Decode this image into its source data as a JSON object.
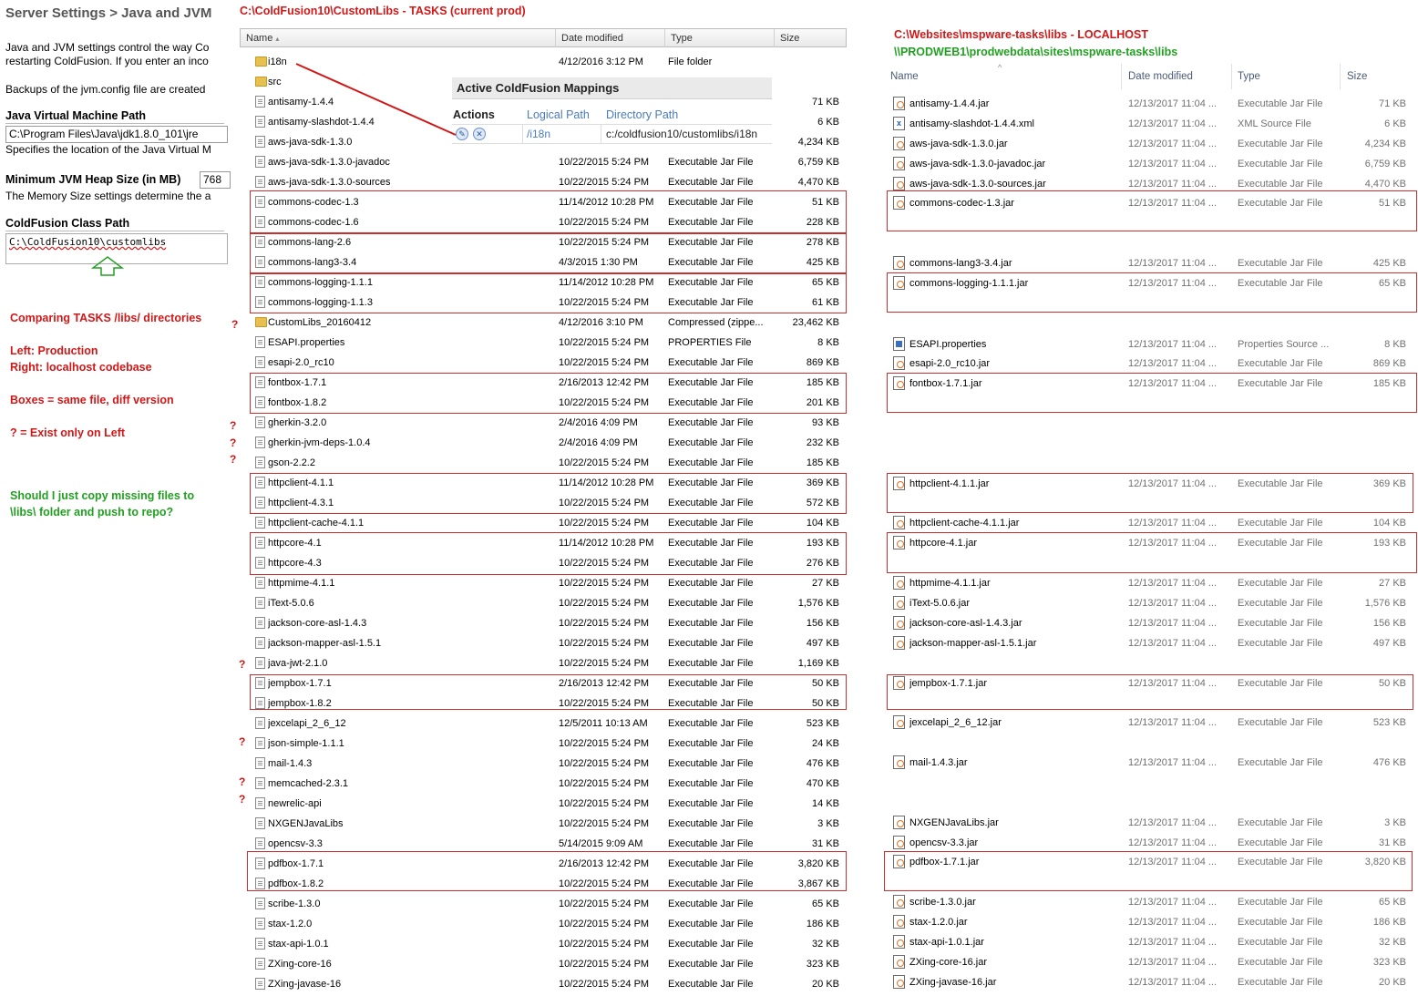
{
  "left_panel": {
    "title": "Server Settings > Java and JVM",
    "desc_line1": "Java and JVM settings control the way Co",
    "desc_line2": "restarting ColdFusion. If you enter an inco",
    "backups_text": "Backups of the jvm.config file are created",
    "jvm_path_label": "Java Virtual Machine Path",
    "jvm_path_value": "C:\\Program Files\\Java\\jdk1.8.0_101\\jre",
    "jvm_path_desc": "Specifies the location of the Java Virtual M",
    "heap_label": "Minimum JVM Heap Size (in MB)",
    "heap_value": "768",
    "heap_desc": "The Memory Size settings determine the a",
    "classpath_label": "ColdFusion Class Path",
    "classpath_value": "C:\\ColdFusion10\\customlibs"
  },
  "annotations": {
    "left_header": "C:\\ColdFusion10\\CustomLibs  - TASKS (current prod)",
    "right_header1": "C:\\Websites\\mspware-tasks\\libs  - LOCALHOST",
    "right_header2": "\\\\PRODWEB1\\prodwebdata\\sites\\mspware-tasks\\libs",
    "comparing": "Comparing TASKS /libs/ directories",
    "left_desc": "Left: Production",
    "right_desc": "Right: localhost codebase",
    "boxes_desc": "Boxes = same file, diff version",
    "q_desc": "? = Exist only on Left",
    "question1": "Should I just copy missing files to",
    "question2": "\\libs\\ folder and push to repo?",
    "qmark": "?",
    "colors": {
      "red": "#d01818",
      "green": "#22a022",
      "box": "#c83030"
    }
  },
  "cf_mappings": {
    "title": "Active ColdFusion Mappings",
    "col_actions": "Actions",
    "col_logical": "Logical Path",
    "col_directory": "Directory Path",
    "row_logical": "/i18n",
    "row_directory": "c:/coldfusion10/customlibs/i18n",
    "edit_icon": "pencil-icon",
    "delete_icon": "x-icon"
  },
  "left_explorer": {
    "columns": {
      "name": "Name",
      "date": "Date modified",
      "type": "Type",
      "size": "Size"
    },
    "rows": [
      {
        "name": "i18n",
        "date": "4/12/2016 3:12 PM",
        "type": "File folder",
        "size": "",
        "icon": "folder-icon"
      },
      {
        "name": "src",
        "date": "",
        "type": "",
        "size": "",
        "icon": "folder-icon"
      },
      {
        "name": "antisamy-1.4.4",
        "date": "",
        "type": "",
        "size": "71 KB",
        "icon": "file-icon"
      },
      {
        "name": "antisamy-slashdot-1.4.4",
        "date": "",
        "type": "",
        "size": "6 KB",
        "icon": "file-icon"
      },
      {
        "name": "aws-java-sdk-1.3.0",
        "date": "",
        "type": "",
        "size": "4,234 KB",
        "icon": "file-icon"
      },
      {
        "name": "aws-java-sdk-1.3.0-javadoc",
        "date": "10/22/2015 5:24 PM",
        "type": "Executable Jar File",
        "size": "6,759 KB",
        "icon": "file-icon"
      },
      {
        "name": "aws-java-sdk-1.3.0-sources",
        "date": "10/22/2015 5:24 PM",
        "type": "Executable Jar File",
        "size": "4,470 KB",
        "icon": "file-icon"
      },
      {
        "name": "commons-codec-1.3",
        "date": "11/14/2012 10:28 PM",
        "type": "Executable Jar File",
        "size": "51 KB",
        "icon": "file-icon"
      },
      {
        "name": "commons-codec-1.6",
        "date": "10/22/2015 5:24 PM",
        "type": "Executable Jar File",
        "size": "228 KB",
        "icon": "file-icon"
      },
      {
        "name": "commons-lang-2.6",
        "date": "10/22/2015 5:24 PM",
        "type": "Executable Jar File",
        "size": "278 KB",
        "icon": "file-icon"
      },
      {
        "name": "commons-lang3-3.4",
        "date": "4/3/2015 1:30 PM",
        "type": "Executable Jar File",
        "size": "425 KB",
        "icon": "file-icon"
      },
      {
        "name": "commons-logging-1.1.1",
        "date": "11/14/2012 10:28 PM",
        "type": "Executable Jar File",
        "size": "65 KB",
        "icon": "file-icon"
      },
      {
        "name": "commons-logging-1.1.3",
        "date": "10/22/2015 5:24 PM",
        "type": "Executable Jar File",
        "size": "61 KB",
        "icon": "file-icon"
      },
      {
        "name": "CustomLibs_20160412",
        "date": "4/12/2016 3:10 PM",
        "type": "Compressed (zippe...",
        "size": "23,462 KB",
        "icon": "zip-folder-icon"
      },
      {
        "name": "ESAPI.properties",
        "date": "10/22/2015 5:24 PM",
        "type": "PROPERTIES File",
        "size": "8 KB",
        "icon": "blank-file-icon"
      },
      {
        "name": "esapi-2.0_rc10",
        "date": "10/22/2015 5:24 PM",
        "type": "Executable Jar File",
        "size": "869 KB",
        "icon": "file-icon"
      },
      {
        "name": "fontbox-1.7.1",
        "date": "2/16/2013 12:42 PM",
        "type": "Executable Jar File",
        "size": "185 KB",
        "icon": "file-icon"
      },
      {
        "name": "fontbox-1.8.2",
        "date": "10/22/2015 5:24 PM",
        "type": "Executable Jar File",
        "size": "201 KB",
        "icon": "file-icon"
      },
      {
        "name": "gherkin-3.2.0",
        "date": "2/4/2016 4:09 PM",
        "type": "Executable Jar File",
        "size": "93 KB",
        "icon": "file-icon"
      },
      {
        "name": "gherkin-jvm-deps-1.0.4",
        "date": "2/4/2016 4:09 PM",
        "type": "Executable Jar File",
        "size": "232 KB",
        "icon": "file-icon"
      },
      {
        "name": "gson-2.2.2",
        "date": "10/22/2015 5:24 PM",
        "type": "Executable Jar File",
        "size": "185 KB",
        "icon": "file-icon"
      },
      {
        "name": "httpclient-4.1.1",
        "date": "11/14/2012 10:28 PM",
        "type": "Executable Jar File",
        "size": "369 KB",
        "icon": "file-icon"
      },
      {
        "name": "httpclient-4.3.1",
        "date": "10/22/2015 5:24 PM",
        "type": "Executable Jar File",
        "size": "572 KB",
        "icon": "file-icon"
      },
      {
        "name": "httpclient-cache-4.1.1",
        "date": "10/22/2015 5:24 PM",
        "type": "Executable Jar File",
        "size": "104 KB",
        "icon": "file-icon"
      },
      {
        "name": "httpcore-4.1",
        "date": "11/14/2012 10:28 PM",
        "type": "Executable Jar File",
        "size": "193 KB",
        "icon": "file-icon"
      },
      {
        "name": "httpcore-4.3",
        "date": "10/22/2015 5:24 PM",
        "type": "Executable Jar File",
        "size": "276 KB",
        "icon": "file-icon"
      },
      {
        "name": "httpmime-4.1.1",
        "date": "10/22/2015 5:24 PM",
        "type": "Executable Jar File",
        "size": "27 KB",
        "icon": "file-icon"
      },
      {
        "name": "iText-5.0.6",
        "date": "10/22/2015 5:24 PM",
        "type": "Executable Jar File",
        "size": "1,576 KB",
        "icon": "file-icon"
      },
      {
        "name": "jackson-core-asl-1.4.3",
        "date": "10/22/2015 5:24 PM",
        "type": "Executable Jar File",
        "size": "156 KB",
        "icon": "file-icon"
      },
      {
        "name": "jackson-mapper-asl-1.5.1",
        "date": "10/22/2015 5:24 PM",
        "type": "Executable Jar File",
        "size": "497 KB",
        "icon": "file-icon"
      },
      {
        "name": "java-jwt-2.1.0",
        "date": "10/22/2015 5:24 PM",
        "type": "Executable Jar File",
        "size": "1,169 KB",
        "icon": "file-icon"
      },
      {
        "name": "jempbox-1.7.1",
        "date": "2/16/2013 12:42 PM",
        "type": "Executable Jar File",
        "size": "50 KB",
        "icon": "file-icon"
      },
      {
        "name": "jempbox-1.8.2",
        "date": "10/22/2015 5:24 PM",
        "type": "Executable Jar File",
        "size": "50 KB",
        "icon": "file-icon"
      },
      {
        "name": "jexcelapi_2_6_12",
        "date": "12/5/2011 10:13 AM",
        "type": "Executable Jar File",
        "size": "523 KB",
        "icon": "file-icon"
      },
      {
        "name": "json-simple-1.1.1",
        "date": "10/22/2015 5:24 PM",
        "type": "Executable Jar File",
        "size": "24 KB",
        "icon": "file-icon"
      },
      {
        "name": "mail-1.4.3",
        "date": "10/22/2015 5:24 PM",
        "type": "Executable Jar File",
        "size": "476 KB",
        "icon": "file-icon"
      },
      {
        "name": "memcached-2.3.1",
        "date": "10/22/2015 5:24 PM",
        "type": "Executable Jar File",
        "size": "470 KB",
        "icon": "file-icon"
      },
      {
        "name": "newrelic-api",
        "date": "10/22/2015 5:24 PM",
        "type": "Executable Jar File",
        "size": "14 KB",
        "icon": "file-icon"
      },
      {
        "name": "NXGENJavaLibs",
        "date": "10/22/2015 5:24 PM",
        "type": "Executable Jar File",
        "size": "3 KB",
        "icon": "file-icon"
      },
      {
        "name": "opencsv-3.3",
        "date": "5/14/2015 9:09 AM",
        "type": "Executable Jar File",
        "size": "31 KB",
        "icon": "file-icon"
      },
      {
        "name": "pdfbox-1.7.1",
        "date": "2/16/2013 12:42 PM",
        "type": "Executable Jar File",
        "size": "3,820 KB",
        "icon": "file-icon"
      },
      {
        "name": "pdfbox-1.8.2",
        "date": "10/22/2015 5:24 PM",
        "type": "Executable Jar File",
        "size": "3,867 KB",
        "icon": "file-icon"
      },
      {
        "name": "scribe-1.3.0",
        "date": "10/22/2015 5:24 PM",
        "type": "Executable Jar File",
        "size": "65 KB",
        "icon": "file-icon"
      },
      {
        "name": "stax-1.2.0",
        "date": "10/22/2015 5:24 PM",
        "type": "Executable Jar File",
        "size": "186 KB",
        "icon": "file-icon"
      },
      {
        "name": "stax-api-1.0.1",
        "date": "10/22/2015 5:24 PM",
        "type": "Executable Jar File",
        "size": "32 KB",
        "icon": "file-icon"
      },
      {
        "name": "ZXing-core-16",
        "date": "10/22/2015 5:24 PM",
        "type": "Executable Jar File",
        "size": "323 KB",
        "icon": "file-icon"
      },
      {
        "name": "ZXing-javase-16",
        "date": "10/22/2015 5:24 PM",
        "type": "Executable Jar File",
        "size": "20 KB",
        "icon": "file-icon"
      }
    ]
  },
  "right_explorer": {
    "columns": {
      "name": "Name",
      "date": "Date modified",
      "type": "Type",
      "size": "Size"
    },
    "rows": [
      {
        "name": "antisamy-1.4.4.jar",
        "date": "12/13/2017 11:04 ...",
        "type": "Executable Jar File",
        "size": "71 KB",
        "icon": "jar-icon"
      },
      {
        "name": "antisamy-slashdot-1.4.4.xml",
        "date": "12/13/2017 11:04 ...",
        "type": "XML Source File",
        "size": "6 KB",
        "icon": "xml-icon"
      },
      {
        "name": "aws-java-sdk-1.3.0.jar",
        "date": "12/13/2017 11:04 ...",
        "type": "Executable Jar File",
        "size": "4,234 KB",
        "icon": "jar-icon"
      },
      {
        "name": "aws-java-sdk-1.3.0-javadoc.jar",
        "date": "12/13/2017 11:04 ...",
        "type": "Executable Jar File",
        "size": "6,759 KB",
        "icon": "jar-icon"
      },
      {
        "name": "aws-java-sdk-1.3.0-sources.jar",
        "date": "12/13/2017 11:04 ...",
        "type": "Executable Jar File",
        "size": "4,470 KB",
        "icon": "jar-icon"
      },
      {
        "name": "commons-codec-1.3.jar",
        "date": "12/13/2017 11:04 ...",
        "type": "Executable Jar File",
        "size": "51 KB",
        "icon": "jar-icon"
      },
      {
        "name": "commons-lang3-3.4.jar",
        "date": "12/13/2017 11:04 ...",
        "type": "Executable Jar File",
        "size": "425 KB",
        "icon": "jar-icon"
      },
      {
        "name": "commons-logging-1.1.1.jar",
        "date": "12/13/2017 11:04 ...",
        "type": "Executable Jar File",
        "size": "65 KB",
        "icon": "jar-icon"
      },
      {
        "name": "ESAPI.properties",
        "date": "12/13/2017 11:04 ...",
        "type": "Properties Source ...",
        "size": "8 KB",
        "icon": "properties-icon"
      },
      {
        "name": "esapi-2.0_rc10.jar",
        "date": "12/13/2017 11:04 ...",
        "type": "Executable Jar File",
        "size": "869 KB",
        "icon": "jar-icon"
      },
      {
        "name": "fontbox-1.7.1.jar",
        "date": "12/13/2017 11:04 ...",
        "type": "Executable Jar File",
        "size": "185 KB",
        "icon": "jar-icon"
      },
      {
        "name": "httpclient-4.1.1.jar",
        "date": "12/13/2017 11:04 ...",
        "type": "Executable Jar File",
        "size": "369 KB",
        "icon": "jar-icon"
      },
      {
        "name": "httpclient-cache-4.1.1.jar",
        "date": "12/13/2017 11:04 ...",
        "type": "Executable Jar File",
        "size": "104 KB",
        "icon": "jar-icon"
      },
      {
        "name": "httpcore-4.1.jar",
        "date": "12/13/2017 11:04 ...",
        "type": "Executable Jar File",
        "size": "193 KB",
        "icon": "jar-icon"
      },
      {
        "name": "httpmime-4.1.1.jar",
        "date": "12/13/2017 11:04 ...",
        "type": "Executable Jar File",
        "size": "27 KB",
        "icon": "jar-icon"
      },
      {
        "name": "iText-5.0.6.jar",
        "date": "12/13/2017 11:04 ...",
        "type": "Executable Jar File",
        "size": "1,576 KB",
        "icon": "jar-icon"
      },
      {
        "name": "jackson-core-asl-1.4.3.jar",
        "date": "12/13/2017 11:04 ...",
        "type": "Executable Jar File",
        "size": "156 KB",
        "icon": "jar-icon"
      },
      {
        "name": "jackson-mapper-asl-1.5.1.jar",
        "date": "12/13/2017 11:04 ...",
        "type": "Executable Jar File",
        "size": "497 KB",
        "icon": "jar-icon"
      },
      {
        "name": "jempbox-1.7.1.jar",
        "date": "12/13/2017 11:04 ...",
        "type": "Executable Jar File",
        "size": "50 KB",
        "icon": "jar-icon"
      },
      {
        "name": "jexcelapi_2_6_12.jar",
        "date": "12/13/2017 11:04 ...",
        "type": "Executable Jar File",
        "size": "523 KB",
        "icon": "jar-icon"
      },
      {
        "name": "mail-1.4.3.jar",
        "date": "12/13/2017 11:04 ...",
        "type": "Executable Jar File",
        "size": "476 KB",
        "icon": "jar-icon"
      },
      {
        "name": "NXGENJavaLibs.jar",
        "date": "12/13/2017 11:04 ...",
        "type": "Executable Jar File",
        "size": "3 KB",
        "icon": "jar-icon"
      },
      {
        "name": "opencsv-3.3.jar",
        "date": "12/13/2017 11:04 ...",
        "type": "Executable Jar File",
        "size": "31 KB",
        "icon": "jar-icon"
      },
      {
        "name": "pdfbox-1.7.1.jar",
        "date": "12/13/2017 11:04 ...",
        "type": "Executable Jar File",
        "size": "3,820 KB",
        "icon": "jar-icon"
      },
      {
        "name": "scribe-1.3.0.jar",
        "date": "12/13/2017 11:04 ...",
        "type": "Executable Jar File",
        "size": "65 KB",
        "icon": "jar-icon"
      },
      {
        "name": "stax-1.2.0.jar",
        "date": "12/13/2017 11:04 ...",
        "type": "Executable Jar File",
        "size": "186 KB",
        "icon": "jar-icon"
      },
      {
        "name": "stax-api-1.0.1.jar",
        "date": "12/13/2017 11:04 ...",
        "type": "Executable Jar File",
        "size": "32 KB",
        "icon": "jar-icon"
      },
      {
        "name": "ZXing-core-16.jar",
        "date": "12/13/2017 11:04 ...",
        "type": "Executable Jar File",
        "size": "323 KB",
        "icon": "jar-icon"
      },
      {
        "name": "ZXing-javase-16.jar",
        "date": "12/13/2017 11:04 ...",
        "type": "Executable Jar File",
        "size": "20 KB",
        "icon": "jar-icon"
      }
    ]
  }
}
